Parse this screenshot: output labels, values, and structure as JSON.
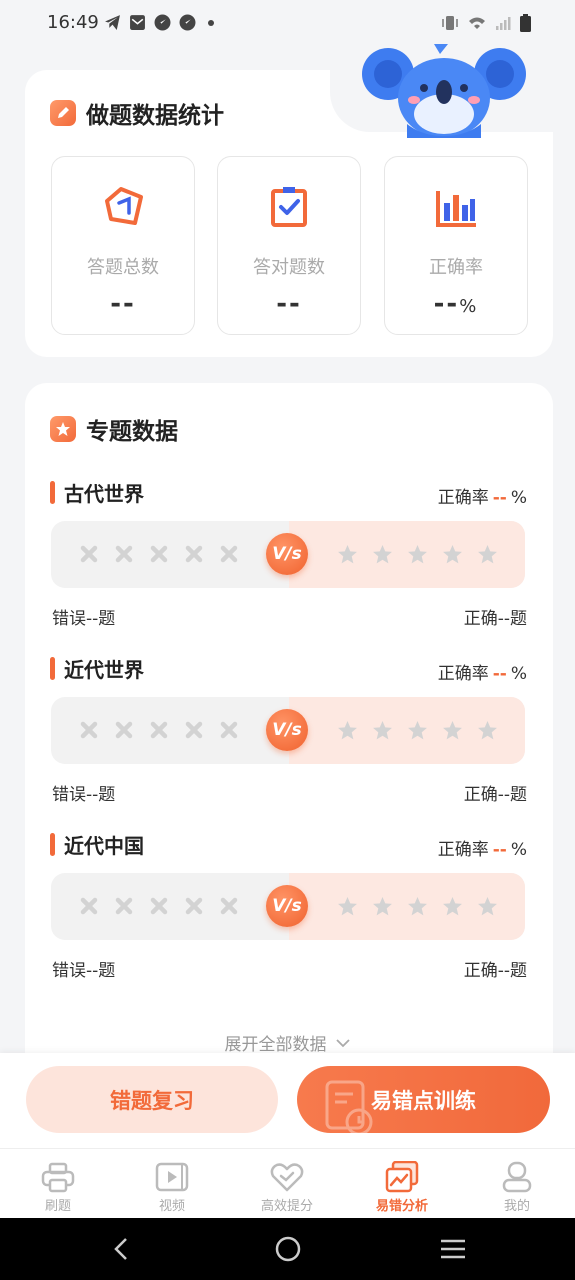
{
  "status_bar": {
    "time": "16:49"
  },
  "stats": {
    "title": "做题数据统计",
    "items": [
      {
        "label": "答题总数",
        "value": "--",
        "unit": ""
      },
      {
        "label": "答对题数",
        "value": "--",
        "unit": ""
      },
      {
        "label": "正确率",
        "value": "--",
        "unit": "%"
      }
    ]
  },
  "topics": {
    "title": "专题数据",
    "rate_label": "正确率",
    "vs_label": "V/s",
    "items": [
      {
        "name": "古代世界",
        "rate": "--",
        "rate_unit": "%",
        "wrong": "错误--题",
        "right": "正确--题"
      },
      {
        "name": "近代世界",
        "rate": "--",
        "rate_unit": "%",
        "wrong": "错误--题",
        "right": "正确--题"
      },
      {
        "name": "近代中国",
        "rate": "--",
        "rate_unit": "%",
        "wrong": "错误--题",
        "right": "正确--题"
      }
    ],
    "expand_label": "展开全部数据"
  },
  "actions": {
    "review_label": "错题复习",
    "train_label": "易错点训练"
  },
  "tabbar": {
    "items": [
      {
        "label": "刷题",
        "icon": "printer-icon"
      },
      {
        "label": "视频",
        "icon": "video-icon"
      },
      {
        "label": "高效提分",
        "icon": "heart-check-icon"
      },
      {
        "label": "易错分析",
        "icon": "chart-image-icon",
        "active": true
      },
      {
        "label": "我的",
        "icon": "person-icon"
      }
    ]
  },
  "colors": {
    "accent": "#f26a3a",
    "accent_light": "#fde4db",
    "background": "#f4f5f7"
  }
}
